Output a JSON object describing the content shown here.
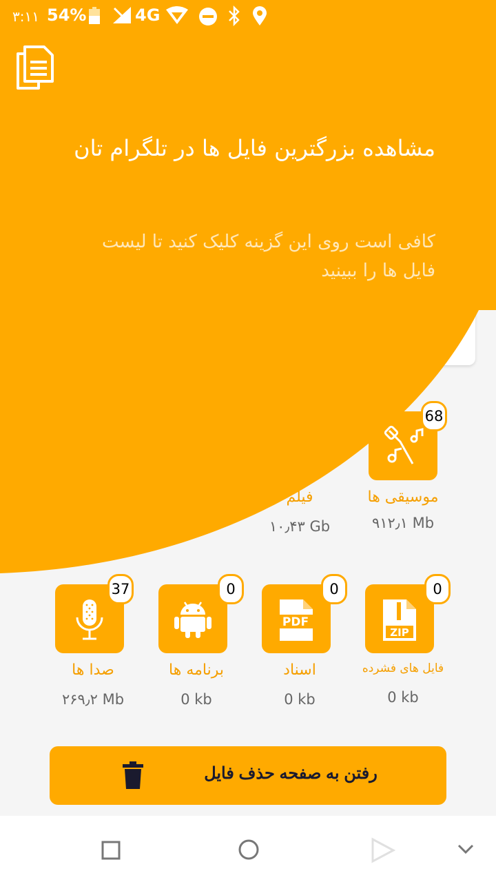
{
  "status_bar": {
    "time": "۳:۱۱",
    "battery_percent": "54%",
    "network": "4G"
  },
  "overlay": {
    "title": "مشاهده بزرگترین فایل ها در تلگرام تان",
    "description": "کافی است روی این گزینه کلیک کنید تا لیست فایل ها را ببینید",
    "icon": "files-icon"
  },
  "categories_top": [
    {
      "label": "موسیقی ها",
      "size": "۹۱۲٫۱ Mb",
      "count": "68",
      "icon": "music-icon"
    },
    {
      "label": "فیلم",
      "size": "۱۰٫۴۳ Gb",
      "count": "",
      "icon": "video-icon"
    }
  ],
  "categories_bottom": [
    {
      "label": "فایل های فشرده",
      "size": "0 kb",
      "count": "0",
      "icon": "zip-file-icon"
    },
    {
      "label": "اسناد",
      "size": "0 kb",
      "count": "0",
      "icon": "pdf-file-icon"
    },
    {
      "label": "برنامه ها",
      "size": "0 kb",
      "count": "0",
      "icon": "android-icon"
    },
    {
      "label": "صدا ها",
      "size": "۲۶۹٫۲ Mb",
      "count": "37",
      "icon": "microphone-icon"
    }
  ],
  "delete_button": {
    "label": "رفتن به صفحه حذف فایل",
    "icon": "trash-icon"
  },
  "nav": {
    "recents_icon": "square-icon",
    "home_icon": "circle-icon",
    "back_icon": "play-icon",
    "expand_icon": "chevron-down-icon"
  },
  "colors": {
    "accent": "#ffaa00",
    "label": "#f59f00",
    "size_text": "#666666",
    "background": "#f5f5f5"
  }
}
